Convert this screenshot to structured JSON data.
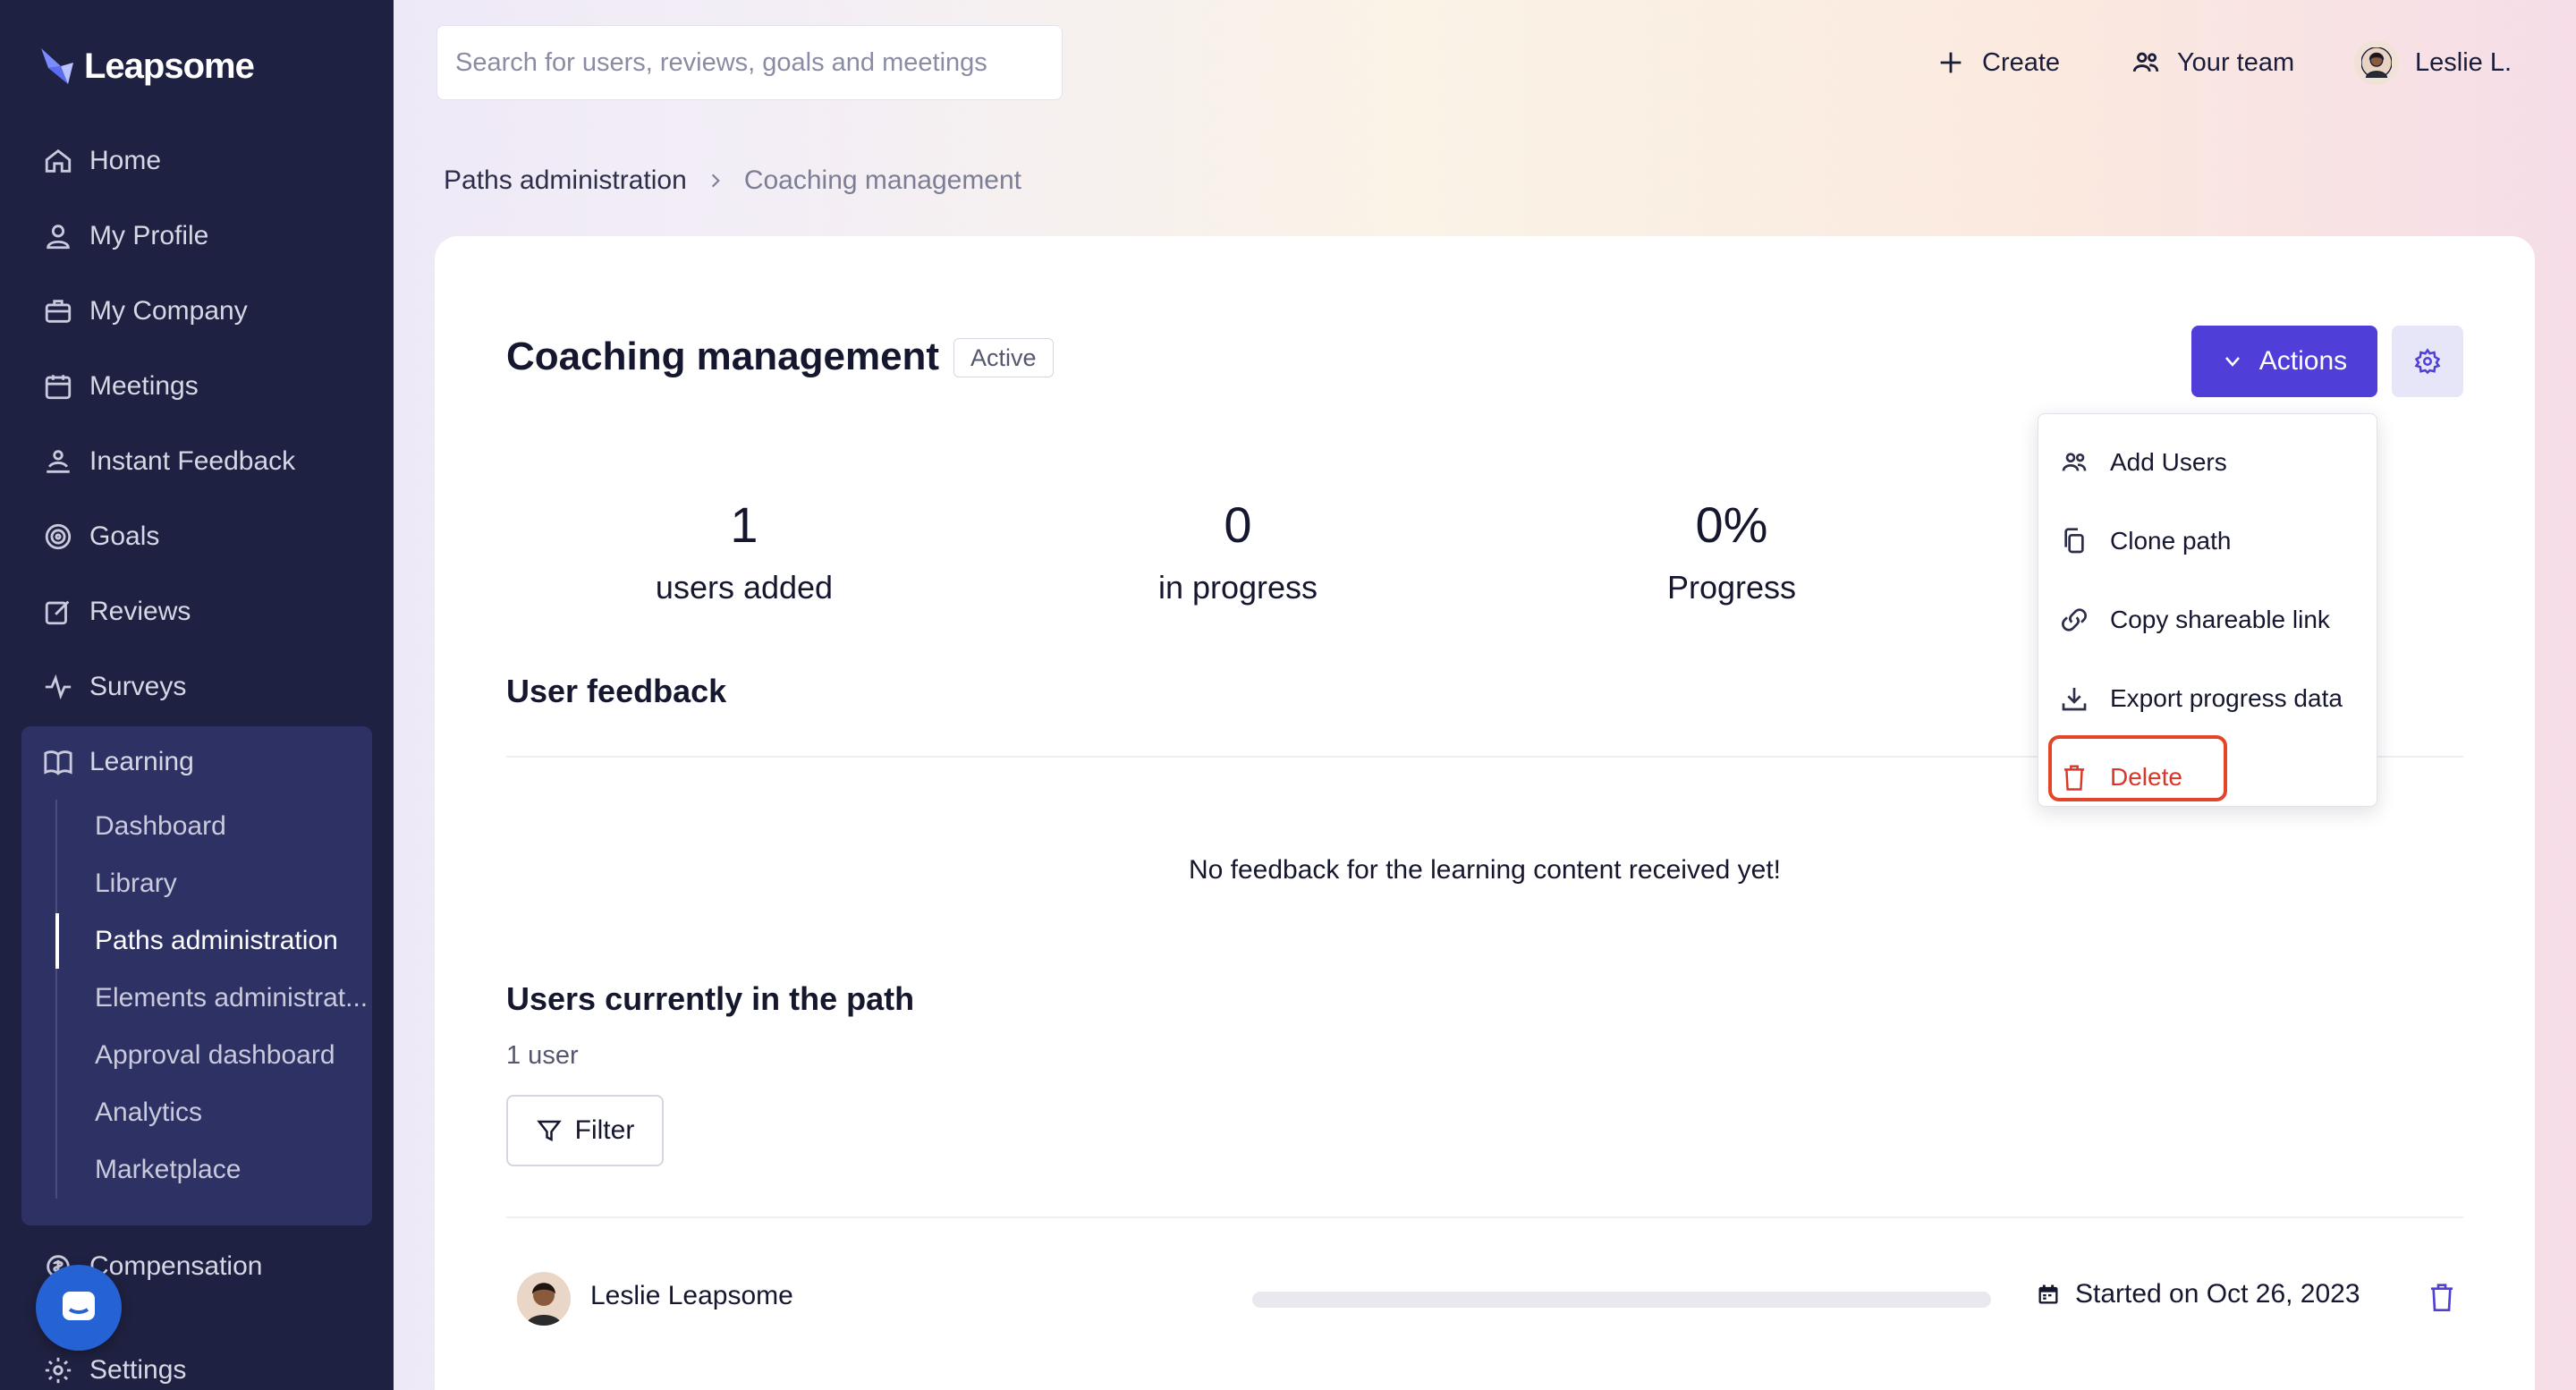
{
  "brand": {
    "name": "Leapsome"
  },
  "sidebar": {
    "items": [
      {
        "label": "Home",
        "icon": "home-icon"
      },
      {
        "label": "My Profile",
        "icon": "user-icon"
      },
      {
        "label": "My Company",
        "icon": "briefcase-icon"
      },
      {
        "label": "Meetings",
        "icon": "calendar-icon"
      },
      {
        "label": "Instant Feedback",
        "icon": "feedback-icon"
      },
      {
        "label": "Goals",
        "icon": "target-icon"
      },
      {
        "label": "Reviews",
        "icon": "edit-icon"
      },
      {
        "label": "Surveys",
        "icon": "pulse-icon"
      },
      {
        "label": "Learning",
        "icon": "book-icon"
      },
      {
        "label": "Compensation",
        "icon": "money-icon"
      },
      {
        "label": "Settings",
        "icon": "gear-icon"
      }
    ],
    "learning_sub": [
      {
        "label": "Dashboard"
      },
      {
        "label": "Library"
      },
      {
        "label": "Paths administration",
        "active": true
      },
      {
        "label": "Elements administrat..."
      },
      {
        "label": "Approval dashboard"
      },
      {
        "label": "Analytics"
      },
      {
        "label": "Marketplace"
      }
    ]
  },
  "topbar": {
    "search_placeholder": "Search for users, reviews, goals and meetings",
    "create_label": "Create",
    "team_label": "Your team",
    "user_label": "Leslie L."
  },
  "breadcrumb": {
    "parent": "Paths administration",
    "current": "Coaching management"
  },
  "path": {
    "title": "Coaching management",
    "status": "Active",
    "actions_label": "Actions",
    "stats": [
      {
        "value": "1",
        "label": "users added"
      },
      {
        "value": "0",
        "label": "in progress"
      },
      {
        "value": "0%",
        "label": "Progress"
      }
    ],
    "feedback_title": "User feedback",
    "feedback_empty": "No feedback for the learning content received yet!",
    "users_title": "Users currently in the path",
    "users_count": "1 user",
    "filter_label": "Filter",
    "users": [
      {
        "name": "Leslie Leapsome",
        "progress": 0,
        "started": "Started on Oct 26, 2023"
      }
    ]
  },
  "actions_menu": {
    "items": [
      {
        "label": "Add Users"
      },
      {
        "label": "Clone path"
      },
      {
        "label": "Copy shareable link"
      },
      {
        "label": "Export progress data"
      },
      {
        "label": "Delete"
      }
    ]
  },
  "colors": {
    "sidebar_bg": "#1f2142",
    "accent": "#4f3fd8",
    "danger": "#d9372a"
  }
}
